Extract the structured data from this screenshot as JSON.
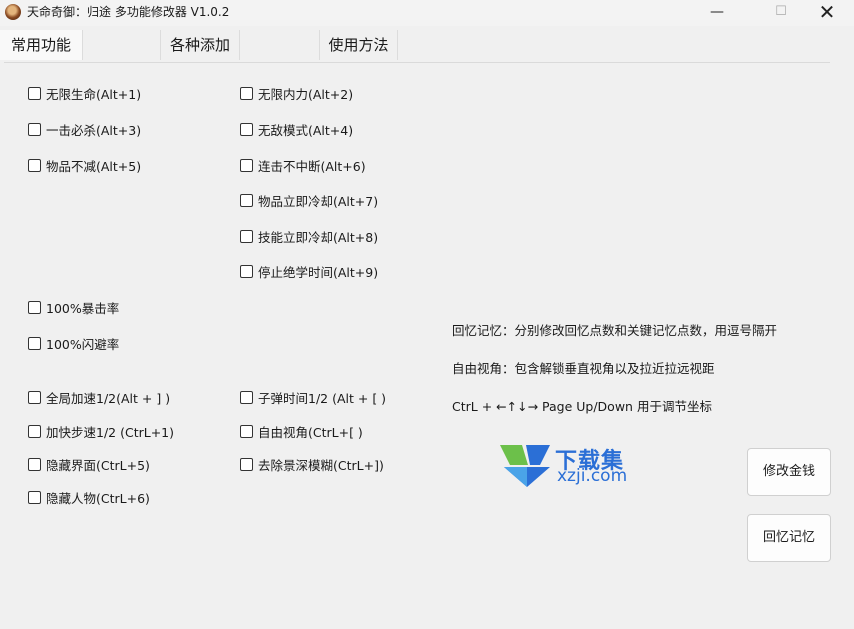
{
  "window": {
    "title": "天命奇御：归途 多功能修改器  V1.0.2",
    "minimize": "—",
    "maximize": "☐",
    "close": "✕"
  },
  "tabs": [
    {
      "label": "常用功能",
      "active": true
    },
    {
      "label": "",
      "active": false
    },
    {
      "label": "各种添加",
      "active": false
    },
    {
      "label": "",
      "active": false
    },
    {
      "label": "使用方法",
      "active": false
    }
  ],
  "options": {
    "infinite_health": "无限生命(Alt+1)",
    "infinite_mana": "无限内力(Alt+2)",
    "one_hit_kill": "一击必杀(Alt+3)",
    "invincible": "无敌模式(Alt+4)",
    "items_no_decrease": "物品不减(Alt+5)",
    "combo_no_break": "连击不中断(Alt+6)",
    "item_cooldown": "物品立即冷却(Alt+7)",
    "skill_cooldown": "技能立即冷却(Alt+8)",
    "stop_skill_time": "停止绝学时间(Alt+9)",
    "crit_100": "100%暴击率",
    "dodge_100": "100%闪避率",
    "global_speed": "全局加速1/2(Alt + ] )",
    "bullet_time": "子弹时间1/2 (Alt + [ )",
    "move_speed": "加快步速1/2 (CtrL+1)",
    "free_camera": "自由视角(CtrL+[ )",
    "hide_ui": "隐藏界面(CtrL+5)",
    "remove_dof": "去除景深模糊(CtrL+])",
    "hide_character": "隐藏人物(CtrL+6)"
  },
  "info": {
    "memory": "回忆记忆：分别修改回忆点数和关键记忆点数，用逗号隔开",
    "camera": "自由视角：包含解锁垂直视角以及拉近拉远视距",
    "coords": "CtrL + ←↑↓→ Page Up/Down 用于调节坐标"
  },
  "watermark": {
    "cn": "下载集",
    "en": "xzji.com"
  },
  "buttons": {
    "money": "修改金钱",
    "memory": "回忆记忆"
  },
  "colors": {
    "watermark_blue": "#2b6fd6",
    "watermark_green": "#6cc04a"
  }
}
